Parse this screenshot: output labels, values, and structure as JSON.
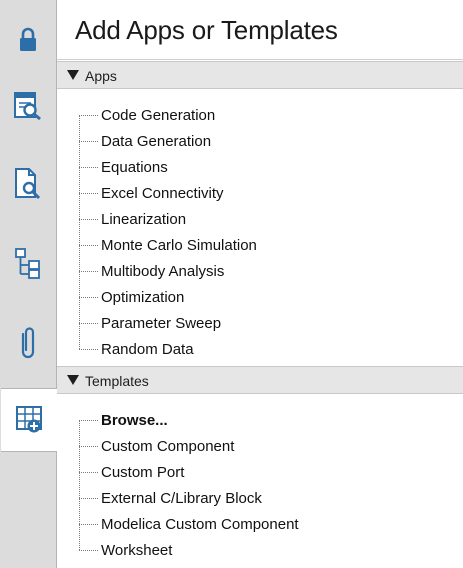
{
  "sidebar": {
    "items": [
      {
        "name": "lock",
        "icon": "lock-icon"
      },
      {
        "name": "search-table",
        "icon": "search-table-icon"
      },
      {
        "name": "document-search",
        "icon": "document-search-icon"
      },
      {
        "name": "tree-structure",
        "icon": "tree-structure-icon"
      },
      {
        "name": "attachment",
        "icon": "paperclip-icon"
      },
      {
        "name": "add-apps-templates",
        "icon": "grid-add-icon",
        "active": true
      }
    ],
    "accent": "#2e6ea8"
  },
  "header": {
    "title": "Add Apps or Templates"
  },
  "sections": {
    "apps": {
      "label": "Apps",
      "items": [
        "Code Generation",
        "Data Generation",
        "Equations",
        "Excel Connectivity",
        "Linearization",
        "Monte Carlo Simulation",
        "Multibody Analysis",
        "Optimization",
        "Parameter Sweep",
        "Random Data"
      ]
    },
    "templates": {
      "label": "Templates",
      "items": [
        "Browse...",
        "Custom Component",
        "Custom Port",
        "External C/Library Block",
        "Modelica Custom Component",
        "Worksheet"
      ]
    }
  }
}
